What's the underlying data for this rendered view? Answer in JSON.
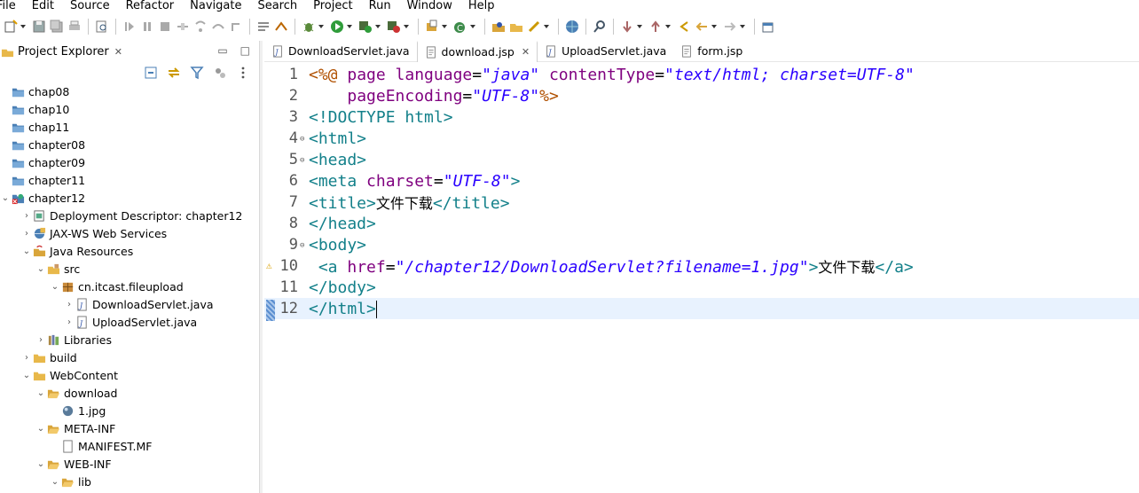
{
  "menu": [
    "File",
    "Edit",
    "Source",
    "Refactor",
    "Navigate",
    "Search",
    "Project",
    "Run",
    "Window",
    "Help"
  ],
  "explorer": {
    "title": "Project Explorer",
    "close": "✕",
    "tree": [
      {
        "label": "chap08",
        "icon": "project-folder-icon",
        "depth": 0,
        "twisty": ""
      },
      {
        "label": "chap10",
        "icon": "project-folder-icon",
        "depth": 0,
        "twisty": ""
      },
      {
        "label": "chap11",
        "icon": "project-folder-icon",
        "depth": 0,
        "twisty": ""
      },
      {
        "label": "chapter08",
        "icon": "project-folder-icon",
        "depth": 0,
        "twisty": ""
      },
      {
        "label": "chapter09",
        "icon": "project-folder-icon",
        "depth": 0,
        "twisty": ""
      },
      {
        "label": "chapter11",
        "icon": "project-folder-icon",
        "depth": 0,
        "twisty": ""
      },
      {
        "label": "chapter12",
        "icon": "web-project-error-icon",
        "depth": 0,
        "twisty": "open"
      },
      {
        "label": "Deployment Descriptor: chapter12",
        "icon": "deployment-descriptor-icon",
        "depth": 1,
        "twisty": "closed"
      },
      {
        "label": "JAX-WS Web Services",
        "icon": "web-services-icon",
        "depth": 1,
        "twisty": "closed"
      },
      {
        "label": "Java Resources",
        "icon": "java-resources-icon",
        "depth": 1,
        "twisty": "open"
      },
      {
        "label": "src",
        "icon": "source-folder-icon",
        "depth": 2,
        "twisty": "open"
      },
      {
        "label": "cn.itcast.fileupload",
        "icon": "package-icon",
        "depth": 3,
        "twisty": "open"
      },
      {
        "label": "DownloadServlet.java",
        "icon": "java-file-icon",
        "depth": 4,
        "twisty": "closed"
      },
      {
        "label": "UploadServlet.java",
        "icon": "java-file-icon",
        "depth": 4,
        "twisty": "closed"
      },
      {
        "label": "Libraries",
        "icon": "libraries-icon",
        "depth": 2,
        "twisty": "closed"
      },
      {
        "label": "build",
        "icon": "folder-icon",
        "depth": 1,
        "twisty": "closed"
      },
      {
        "label": "WebContent",
        "icon": "folder-icon",
        "depth": 1,
        "twisty": "open"
      },
      {
        "label": "download",
        "icon": "folder-open-icon",
        "depth": 2,
        "twisty": "open"
      },
      {
        "label": "1.jpg",
        "icon": "image-file-icon",
        "depth": 3,
        "twisty": ""
      },
      {
        "label": "META-INF",
        "icon": "folder-open-icon",
        "depth": 2,
        "twisty": "open"
      },
      {
        "label": "MANIFEST.MF",
        "icon": "text-file-icon",
        "depth": 3,
        "twisty": ""
      },
      {
        "label": "WEB-INF",
        "icon": "folder-open-icon",
        "depth": 2,
        "twisty": "open"
      },
      {
        "label": "lib",
        "icon": "folder-open-icon",
        "depth": 3,
        "twisty": "open"
      }
    ]
  },
  "editor": {
    "tabs": [
      {
        "label": "DownloadServlet.java",
        "icon": "java-file-icon",
        "active": false
      },
      {
        "label": "download.jsp",
        "icon": "jsp-file-icon",
        "active": true
      },
      {
        "label": "UploadServlet.java",
        "icon": "java-file-icon",
        "active": false
      },
      {
        "label": "form.jsp",
        "icon": "jsp-file-icon",
        "active": false
      }
    ],
    "tab_close": "✕",
    "lines": [
      {
        "n": "1",
        "fold": "",
        "segs": [
          [
            "dir",
            "<%@ "
          ],
          [
            "attr",
            "page "
          ],
          [
            "attr",
            "language"
          ],
          [
            "txt0",
            "="
          ],
          [
            "val",
            "\"java\""
          ],
          [
            "txt0",
            " "
          ],
          [
            "attr",
            "contentType"
          ],
          [
            "txt0",
            "="
          ],
          [
            "val",
            "\"text/html; charset=UTF-8\""
          ]
        ]
      },
      {
        "n": "2",
        "fold": "",
        "segs": [
          [
            "txt0",
            "    "
          ],
          [
            "attr",
            "pageEncoding"
          ],
          [
            "txt0",
            "="
          ],
          [
            "val",
            "\"UTF-8\""
          ],
          [
            "dir",
            "%>"
          ]
        ]
      },
      {
        "n": "3",
        "fold": "",
        "segs": [
          [
            "tag",
            "<!DOCTYPE "
          ],
          [
            "tag",
            "html"
          ],
          [
            "tag",
            ">"
          ]
        ]
      },
      {
        "n": "4",
        "fold": "⊖",
        "segs": [
          [
            "tag",
            "<html>"
          ]
        ]
      },
      {
        "n": "5",
        "fold": "⊖",
        "segs": [
          [
            "tag",
            "<head>"
          ]
        ]
      },
      {
        "n": "6",
        "fold": "",
        "segs": [
          [
            "tag",
            "<meta "
          ],
          [
            "attr",
            "charset"
          ],
          [
            "txt0",
            "="
          ],
          [
            "val",
            "\"UTF-8\""
          ],
          [
            "tag",
            ">"
          ]
        ]
      },
      {
        "n": "7",
        "fold": "",
        "segs": [
          [
            "tag",
            "<title>"
          ],
          [
            "txt",
            "文件下载"
          ],
          [
            "tag",
            "</title>"
          ]
        ]
      },
      {
        "n": "8",
        "fold": "",
        "segs": [
          [
            "tag",
            "</head>"
          ]
        ]
      },
      {
        "n": "9",
        "fold": "⊖",
        "segs": [
          [
            "tag",
            "<body>"
          ]
        ]
      },
      {
        "n": "10",
        "fold": "",
        "warn": true,
        "segs": [
          [
            "txt0",
            " "
          ],
          [
            "tag",
            "<a "
          ],
          [
            "attr",
            "href"
          ],
          [
            "txt0",
            "="
          ],
          [
            "val",
            "\"/chapter12/DownloadServlet?filename=1.jpg\""
          ],
          [
            "tag",
            ">"
          ],
          [
            "txt",
            "文件下载"
          ],
          [
            "tag",
            "</a>"
          ]
        ]
      },
      {
        "n": "11",
        "fold": "",
        "segs": [
          [
            "tag",
            "</body>"
          ]
        ]
      },
      {
        "n": "12",
        "fold": "",
        "current": true,
        "segs": [
          [
            "tag",
            "</html>"
          ]
        ]
      }
    ]
  },
  "colors": {
    "tag": "#13808a",
    "attr": "#7f007f",
    "val": "#2a00ff",
    "dir": "#b05000",
    "current_line": "#e8f2fe"
  }
}
